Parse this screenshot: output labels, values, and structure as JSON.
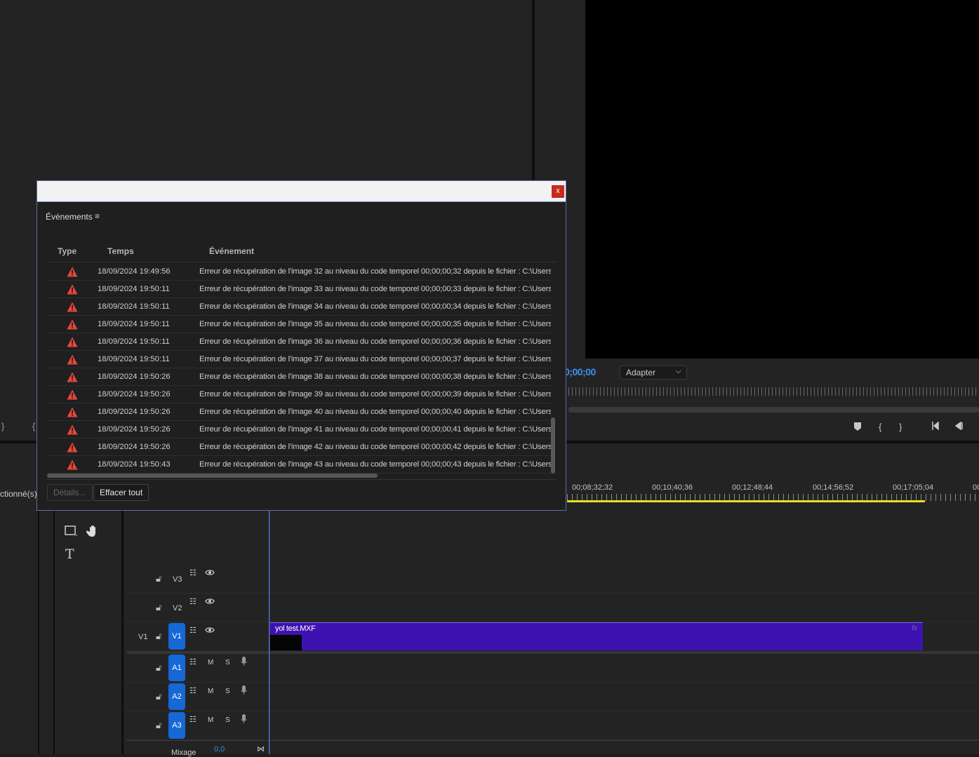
{
  "monitor": {
    "timecode": "0;00;00",
    "fit_label": "Adapter"
  },
  "timeline": {
    "left_label": "ctionné(s)",
    "ruler_labels": [
      "00;08;32;32",
      "00;10;40;36",
      "00;12;48;44",
      "00;14;56;52",
      "00;17;05;04",
      "00"
    ],
    "tracks": [
      {
        "badge": "",
        "name": "V3"
      },
      {
        "badge": "",
        "name": "V2"
      },
      {
        "badge": "V1",
        "name": "V1",
        "source": "V1"
      },
      {
        "badge": "A1",
        "name": ""
      },
      {
        "badge": "A2",
        "name": ""
      },
      {
        "badge": "A3",
        "name": ""
      }
    ],
    "clip": {
      "name": "yol test.MXF",
      "fx": "fx"
    },
    "mix_label": "Mixage",
    "mix_value": "0,0",
    "audio_m": "M",
    "audio_s": "S"
  },
  "dialog": {
    "close_label": "x",
    "panel_title": "Événements",
    "menu_icon": "≡",
    "columns": {
      "type": "Type",
      "time": "Temps",
      "event": "Événement"
    },
    "rows": [
      {
        "time": "18/09/2024 19:49:56",
        "msg": "Erreur de récupération de l'image 32 au niveau du code temporel 00;00;00;32 depuis le fichier : C:\\Users"
      },
      {
        "time": "18/09/2024 19:50:11",
        "msg": "Erreur de récupération de l'image 33 au niveau du code temporel 00;00;00;33 depuis le fichier : C:\\Users"
      },
      {
        "time": "18/09/2024 19:50:11",
        "msg": "Erreur de récupération de l'image 34 au niveau du code temporel 00;00;00;34 depuis le fichier : C:\\Users"
      },
      {
        "time": "18/09/2024 19:50:11",
        "msg": "Erreur de récupération de l'image 35 au niveau du code temporel 00;00;00;35 depuis le fichier : C:\\Users"
      },
      {
        "time": "18/09/2024 19:50:11",
        "msg": "Erreur de récupération de l'image 36 au niveau du code temporel 00;00;00;36 depuis le fichier : C:\\Users"
      },
      {
        "time": "18/09/2024 19:50:11",
        "msg": "Erreur de récupération de l'image 37 au niveau du code temporel 00;00;00;37 depuis le fichier : C:\\Users"
      },
      {
        "time": "18/09/2024 19:50:26",
        "msg": "Erreur de récupération de l'image 38 au niveau du code temporel 00;00;00;38 depuis le fichier : C:\\Users"
      },
      {
        "time": "18/09/2024 19:50:26",
        "msg": "Erreur de récupération de l'image 39 au niveau du code temporel 00;00;00;39 depuis le fichier : C:\\Users"
      },
      {
        "time": "18/09/2024 19:50:26",
        "msg": "Erreur de récupération de l'image 40 au niveau du code temporel 00;00;00;40 depuis le fichier : C:\\Users"
      },
      {
        "time": "18/09/2024 19:50:26",
        "msg": "Erreur de récupération de l'image 41 au niveau du code temporel 00;00;00;41 depuis le fichier : C:\\Users"
      },
      {
        "time": "18/09/2024 19:50:26",
        "msg": "Erreur de récupération de l'image 42 au niveau du code temporel 00;00;00;42 depuis le fichier : C:\\Users"
      },
      {
        "time": "18/09/2024 19:50:43",
        "msg": "Erreur de récupération de l'image 43 au niveau du code temporel 00;00;00;43 depuis le fichier : C:\\Users"
      }
    ],
    "details_button": "Détails...",
    "clear_button": "Effacer tout"
  },
  "colors": {
    "accent_blue": "#1668d6",
    "clip_purple": "#3e12b0",
    "warning_red": "#e8453c",
    "close_red": "#c42b1c",
    "work_area_yellow": "#e7e020"
  }
}
